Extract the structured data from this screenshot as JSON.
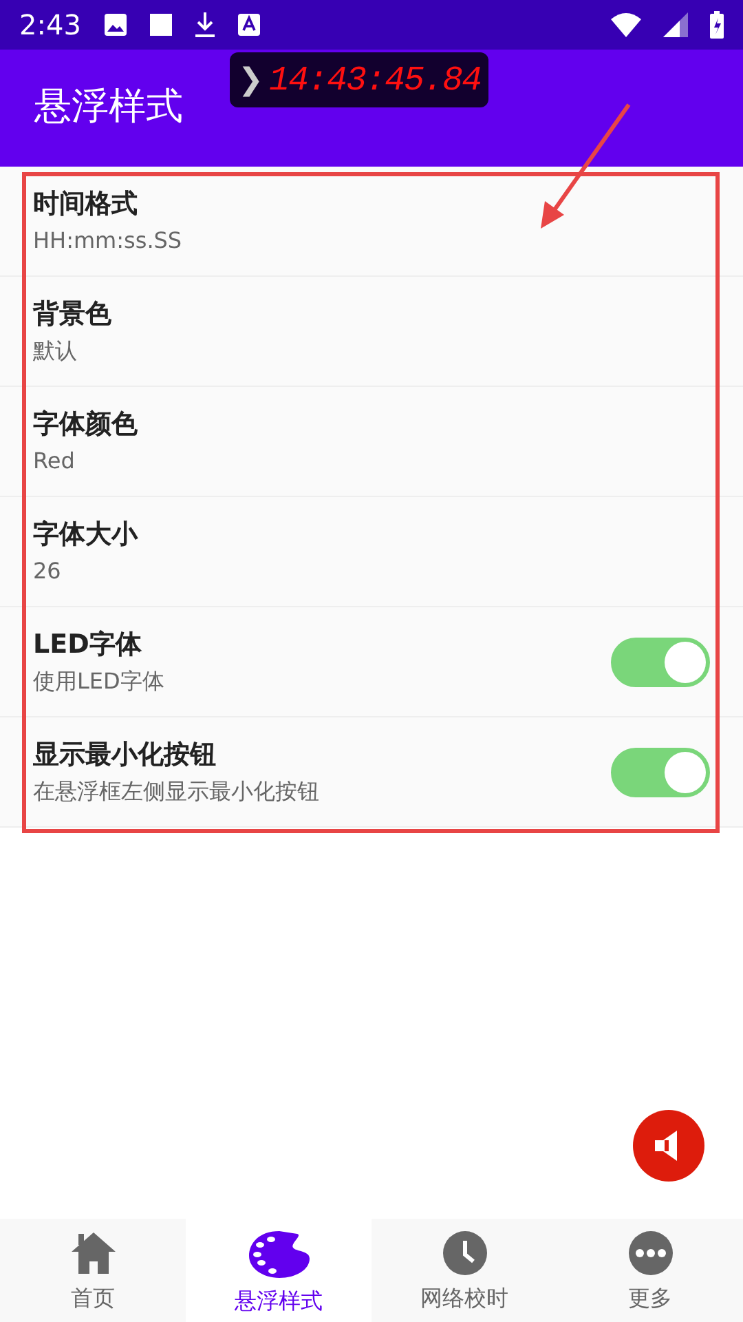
{
  "status_bar": {
    "time": "2:43"
  },
  "app_bar": {
    "title": "悬浮样式"
  },
  "floating_clock": {
    "time": "14:43:45.84",
    "chevron": "❯"
  },
  "settings": [
    {
      "kind": "text",
      "title": "时间格式",
      "summary": "HH:mm:ss.SS"
    },
    {
      "kind": "text",
      "title": "背景色",
      "summary": "默认"
    },
    {
      "kind": "text",
      "title": "字体颜色",
      "summary": "Red"
    },
    {
      "kind": "text",
      "title": "字体大小",
      "summary": "26"
    },
    {
      "kind": "switch",
      "title": "LED字体",
      "summary": "使用LED字体",
      "on": true
    },
    {
      "kind": "switch",
      "title": "显示最小化按钮",
      "summary": "在悬浮框左侧显示最小化按钮",
      "on": true
    }
  ],
  "bottom_nav": [
    {
      "label": "首页",
      "selected": false
    },
    {
      "label": "悬浮样式",
      "selected": true
    },
    {
      "label": "网络校时",
      "selected": false
    },
    {
      "label": "更多",
      "selected": false
    }
  ]
}
